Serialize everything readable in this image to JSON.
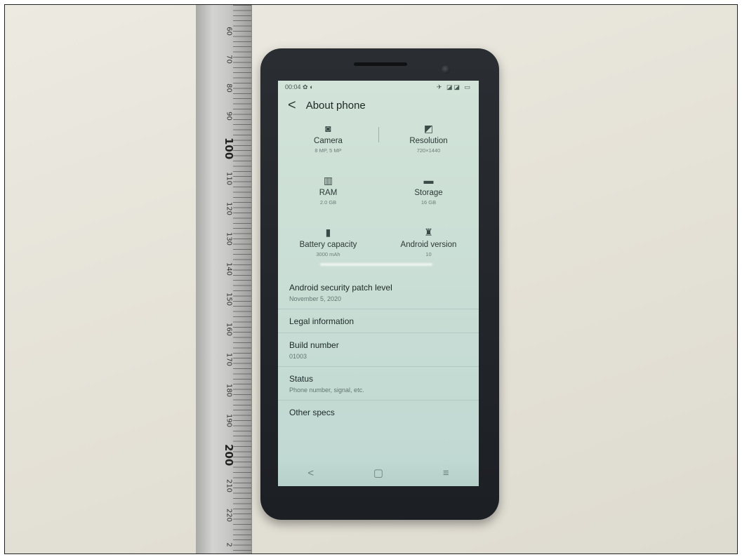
{
  "ruler": {
    "numbers": [
      "60",
      "70",
      "80",
      "90",
      "100",
      "110",
      "120",
      "130",
      "140",
      "150",
      "160",
      "170",
      "180",
      "190",
      "200",
      "210",
      "220",
      "2"
    ]
  },
  "status_bar": {
    "time": "00:04",
    "left_icons": "✿ ◐",
    "right_icons": "✈ ◪◪ ▭"
  },
  "header": {
    "back_icon": "chevron-left-icon",
    "back_glyph": "<",
    "title": "About phone"
  },
  "specs": [
    {
      "icon": "camera-icon",
      "glyph": "◙",
      "label": "Camera",
      "value": "8 MP, 5 MP"
    },
    {
      "icon": "resolution-icon",
      "glyph": "◩",
      "label": "Resolution",
      "value": "720×1440"
    },
    {
      "icon": "ram-icon",
      "glyph": "▥",
      "label": "RAM",
      "value": "2.0 GB"
    },
    {
      "icon": "storage-icon",
      "glyph": "▬",
      "label": "Storage",
      "value": "16 GB"
    },
    {
      "icon": "battery-icon",
      "glyph": "▮",
      "label": "Battery capacity",
      "value": "3000 mAh"
    },
    {
      "icon": "android-icon",
      "glyph": "♜",
      "label": "Android version",
      "value": "10"
    }
  ],
  "list": [
    {
      "title": "Android security patch level",
      "subtitle": "November 5, 2020"
    },
    {
      "title": "Legal information",
      "subtitle": ""
    },
    {
      "title": "Build number",
      "subtitle": "01003"
    },
    {
      "title": "Status",
      "subtitle": "Phone number, signal, etc."
    },
    {
      "title": "Other specs",
      "subtitle": ""
    }
  ],
  "nav_bar": {
    "back_glyph": "<",
    "home_glyph": "▢",
    "menu_glyph": "≡"
  }
}
